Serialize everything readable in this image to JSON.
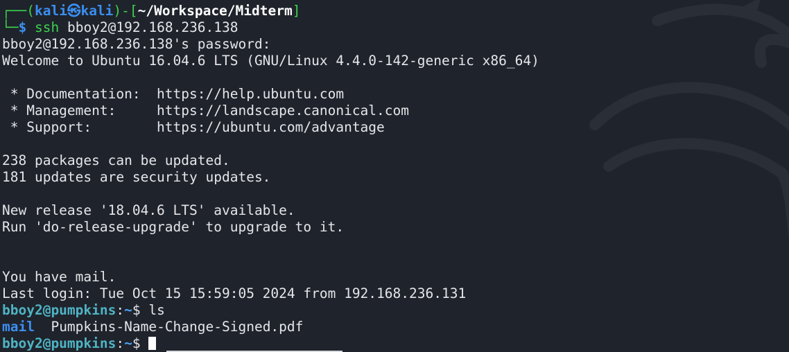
{
  "terminal": {
    "prompt1": {
      "box_top": "┌──(",
      "user": "kali",
      "at": "㉿",
      "host": "kali",
      "close": ")-[",
      "path": "~/Workspace/Midterm",
      "end": "]",
      "box_bottom": "└─",
      "dollar": "$",
      "command": "ssh",
      "args": "bboy2@192.168.236.138"
    },
    "output": [
      "bboy2@192.168.236.138's password: ",
      "Welcome to Ubuntu 16.04.6 LTS (GNU/Linux 4.4.0-142-generic x86_64)",
      "",
      " * Documentation:  https://help.ubuntu.com",
      " * Management:     https://landscape.canonical.com",
      " * Support:        https://ubuntu.com/advantage",
      "",
      "238 packages can be updated.",
      "181 updates are security updates.",
      "",
      "New release '18.04.6 LTS' available.",
      "Run 'do-release-upgrade' to upgrade to it.",
      "",
      "",
      "You have mail.",
      "Last login: Tue Oct 15 15:59:05 2024 from 192.168.236.131"
    ],
    "prompt2": {
      "user_host": "bboy2@pumpkins",
      "colon": ":",
      "path": "~",
      "dollar": "$ ",
      "command": "ls"
    },
    "ls_output": {
      "dir": "mail",
      "separator": "  ",
      "file": "Pumpkins-Name-Change-Signed.pdf"
    },
    "prompt3": {
      "user_host": "bboy2@pumpkins",
      "colon": ":",
      "path": "~",
      "dollar": "$ "
    }
  },
  "colors": {
    "background": "#1f232b",
    "text": "#e4e6ea",
    "accent_blue": "#3b8ff0",
    "accent_green": "#3dd24f",
    "prompt_user": "#4fb3c4"
  },
  "icons": {
    "background_logo": "kali-dragon-icon",
    "cursor": "block-cursor"
  }
}
